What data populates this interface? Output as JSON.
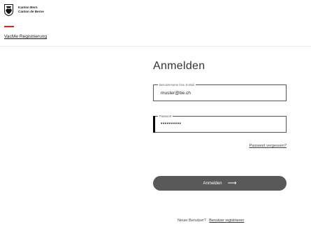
{
  "header": {
    "brand_line1": "Kanton Bern",
    "brand_line2": "Canton de Berne",
    "app_link": "VacMe Registrierung",
    "accent_color": "#e2231a"
  },
  "login": {
    "title": "Anmelden",
    "username": {
      "label": "Benutzername bzw. E-Mail",
      "value": "muster@be.ch"
    },
    "password": {
      "label": "Passwort",
      "value": "••••••••••"
    },
    "forgot_link": "Passwort vergessen?",
    "submit_label": "Anmelden",
    "submit_icon": "arrow-right-icon",
    "new_user_text": "Neuer Benutzer?",
    "register_link": "Benutzer registrieren"
  }
}
